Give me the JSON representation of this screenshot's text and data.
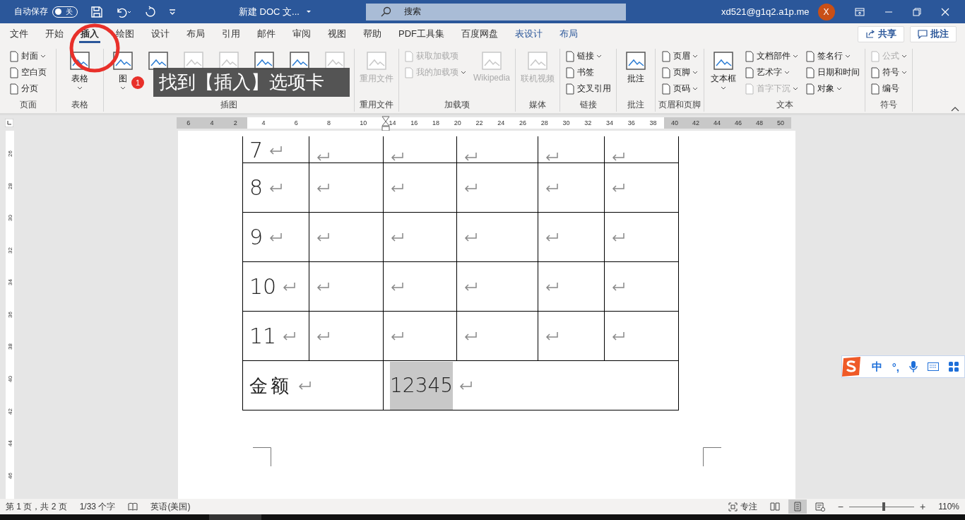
{
  "title_bar": {
    "autosave_label": "自动保存",
    "autosave": {
      "on": false,
      "label": "关"
    },
    "document_title": "新建 DOC 文...",
    "search_placeholder": "搜索",
    "account": "xd521@g1q2.a1p.me",
    "avatar": "X"
  },
  "tabs": [
    {
      "label": "文件",
      "selected": false,
      "kind": "normal"
    },
    {
      "label": "开始",
      "selected": false,
      "kind": "normal"
    },
    {
      "label": "插入",
      "selected": true,
      "kind": "normal"
    },
    {
      "label": "绘图",
      "selected": false,
      "kind": "normal"
    },
    {
      "label": "设计",
      "selected": false,
      "kind": "normal"
    },
    {
      "label": "布局",
      "selected": false,
      "kind": "normal"
    },
    {
      "label": "引用",
      "selected": false,
      "kind": "normal"
    },
    {
      "label": "邮件",
      "selected": false,
      "kind": "normal"
    },
    {
      "label": "审阅",
      "selected": false,
      "kind": "normal"
    },
    {
      "label": "视图",
      "selected": false,
      "kind": "normal"
    },
    {
      "label": "帮助",
      "selected": false,
      "kind": "normal"
    },
    {
      "label": "PDF工具集",
      "selected": false,
      "kind": "normal"
    },
    {
      "label": "百度网盘",
      "selected": false,
      "kind": "normal"
    },
    {
      "label": "表设计",
      "selected": false,
      "kind": "contextual"
    },
    {
      "label": "布局",
      "selected": false,
      "kind": "contextual"
    }
  ],
  "actions": [
    {
      "label": "共享"
    },
    {
      "label": "批注"
    }
  ],
  "ribbon": {
    "groups": [
      {
        "label": "页面",
        "items": [
          {
            "kind": "small",
            "label": "封面",
            "dropdown": true,
            "disabled": false
          },
          {
            "kind": "small",
            "label": "空白页",
            "dropdown": false,
            "disabled": false
          },
          {
            "kind": "small",
            "label": "分页",
            "dropdown": false,
            "disabled": false
          }
        ]
      },
      {
        "label": "表格",
        "items": [
          {
            "kind": "large",
            "label": "表格",
            "dropdown": true,
            "disabled": false
          }
        ]
      },
      {
        "label": "插图",
        "items": [
          {
            "kind": "large",
            "label": "图",
            "dropdown": true,
            "disabled": false
          },
          {
            "kind": "large",
            "dropdown": false,
            "disabled": false
          },
          {
            "kind": "large",
            "dropdown": false,
            "disabled": true
          },
          {
            "kind": "large",
            "dropdown": false,
            "disabled": true
          },
          {
            "kind": "large",
            "dropdown": false,
            "disabled": false
          },
          {
            "kind": "large",
            "dropdown": false,
            "disabled": false
          },
          {
            "kind": "large",
            "dropdown": false,
            "disabled": true
          }
        ]
      },
      {
        "label": "重用文件",
        "items": [
          {
            "kind": "large",
            "label": "重用文件",
            "dropdown": false,
            "disabled": true
          }
        ]
      },
      {
        "label": "加载项",
        "items": [
          {
            "kind": "small",
            "label": "获取加载项",
            "dropdown": false,
            "disabled": true
          },
          {
            "kind": "small",
            "label": "我的加载项",
            "dropdown": true,
            "disabled": true
          },
          {
            "kind": "large",
            "label": "Wikipedia",
            "dropdown": false,
            "disabled": true
          }
        ]
      },
      {
        "label": "媒体",
        "items": [
          {
            "kind": "large",
            "label": "联机视频",
            "dropdown": false,
            "disabled": true
          }
        ]
      },
      {
        "label": "链接",
        "items": [
          {
            "kind": "small",
            "label": "链接",
            "dropdown": true,
            "disabled": false
          },
          {
            "kind": "small",
            "label": "书签",
            "dropdown": false,
            "disabled": false
          },
          {
            "kind": "small",
            "label": "交叉引用",
            "dropdown": false,
            "disabled": false
          }
        ]
      },
      {
        "label": "批注",
        "items": [
          {
            "kind": "large",
            "label": "批注",
            "dropdown": false,
            "disabled": false
          }
        ]
      },
      {
        "label": "页眉和页脚",
        "items": [
          {
            "kind": "small",
            "label": "页眉",
            "dropdown": true,
            "disabled": false
          },
          {
            "kind": "small",
            "label": "页脚",
            "dropdown": true,
            "disabled": false
          },
          {
            "kind": "small",
            "label": "页码",
            "dropdown": true,
            "disabled": false
          }
        ]
      },
      {
        "label": "文本",
        "items": [
          {
            "kind": "large",
            "label": "文本框",
            "dropdown": true,
            "disabled": false
          },
          {
            "kind": "small",
            "label": "文档部件",
            "dropdown": true,
            "disabled": false
          },
          {
            "kind": "small",
            "label": "艺术字",
            "dropdown": true,
            "disabled": false
          },
          {
            "kind": "small",
            "label": "首字下沉",
            "dropdown": true,
            "disabled": true
          },
          {
            "kind": "small",
            "label": "签名行",
            "dropdown": true,
            "disabled": false
          },
          {
            "kind": "small",
            "label": "日期和时间",
            "dropdown": false,
            "disabled": false
          },
          {
            "kind": "small",
            "label": "对象",
            "dropdown": true,
            "disabled": false
          }
        ]
      },
      {
        "label": "符号",
        "items": [
          {
            "kind": "small",
            "label": "公式",
            "dropdown": true,
            "disabled": true
          },
          {
            "kind": "small",
            "label": "符号",
            "dropdown": true,
            "disabled": false
          },
          {
            "kind": "small",
            "label": "编号",
            "dropdown": false,
            "disabled": false
          }
        ]
      }
    ]
  },
  "callout": {
    "number": "1",
    "text": "找到【插入】选项卡"
  },
  "ruler": {
    "segments": [
      {
        "kind": "margin",
        "labels": [
          "6",
          "4",
          "2"
        ]
      },
      {
        "kind": "text",
        "labels": [
          "4",
          "6",
          "8",
          "10"
        ]
      },
      {
        "kind": "text",
        "labels": [
          "14",
          "16",
          "18",
          "20",
          "22",
          "24",
          "26",
          "28",
          "30",
          "32",
          "34",
          "36",
          "38"
        ]
      },
      {
        "kind": "margin",
        "labels": [
          "40",
          "42",
          "44",
          "46",
          "48",
          "50"
        ]
      }
    ]
  },
  "vertical_ruler": [
    "26",
    "28",
    "30",
    "32",
    "34",
    "36",
    "38",
    "40",
    "42",
    "44",
    "46"
  ],
  "table": {
    "rows": [
      {
        "kind": "partial",
        "cells": [
          {
            "kind": "text",
            "text": "7"
          },
          {
            "kind": "blank"
          },
          {
            "kind": "blank"
          },
          {
            "kind": "blank"
          },
          {
            "kind": "blank"
          },
          {
            "kind": "blank"
          }
        ]
      },
      {
        "kind": "normal",
        "cells": [
          {
            "kind": "text",
            "text": "8"
          },
          {
            "kind": "blank"
          },
          {
            "kind": "blank"
          },
          {
            "kind": "blank"
          },
          {
            "kind": "blank"
          },
          {
            "kind": "blank"
          }
        ]
      },
      {
        "kind": "normal",
        "cells": [
          {
            "kind": "text",
            "text": "9"
          },
          {
            "kind": "blank"
          },
          {
            "kind": "blank"
          },
          {
            "kind": "blank"
          },
          {
            "kind": "blank"
          },
          {
            "kind": "blank"
          }
        ]
      },
      {
        "kind": "normal",
        "cells": [
          {
            "kind": "text",
            "text": "10"
          },
          {
            "kind": "blank"
          },
          {
            "kind": "blank"
          },
          {
            "kind": "blank"
          },
          {
            "kind": "blank"
          },
          {
            "kind": "blank"
          }
        ]
      },
      {
        "kind": "normal",
        "cells": [
          {
            "kind": "text",
            "text": "11"
          },
          {
            "kind": "blank"
          },
          {
            "kind": "blank"
          },
          {
            "kind": "blank"
          },
          {
            "kind": "blank"
          },
          {
            "kind": "blank"
          }
        ]
      },
      {
        "kind": "total",
        "cells": [
          {
            "kind": "label",
            "text": "金额",
            "selected": false
          },
          {
            "kind": "value",
            "text": "12345",
            "selected": true
          }
        ]
      }
    ]
  },
  "ime": {
    "mode": "中",
    "punctuation": "°,"
  },
  "status_bar": {
    "page": "第 1 页，共 2 页",
    "words": "1/33 个字",
    "language": "英语(美国)",
    "focus": "专注",
    "zoom_out": "−",
    "zoom_slider": {
      "level": 0.53
    },
    "zoom_in": "+",
    "zoom": "110%"
  }
}
